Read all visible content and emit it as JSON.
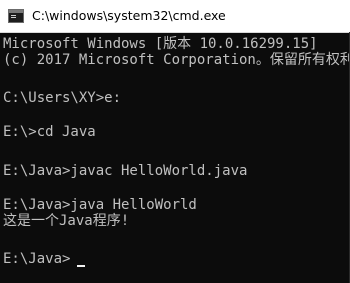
{
  "window": {
    "title": "C:\\windows\\system32\\cmd.exe"
  },
  "console": {
    "lines": [
      "Microsoft Windows [版本 10.0.16299.15]",
      "(c) 2017 Microsoft Corporation。保留所有权利。",
      "",
      "C:\\Users\\XY>e:",
      "",
      "E:\\>cd Java",
      "",
      "E:\\Java>javac HelloWorld.java",
      "",
      "E:\\Java>java HelloWorld",
      "这是一个Java程序!",
      "",
      "E:\\Java>"
    ]
  },
  "colors": {
    "console_background": "#0c0c0c",
    "console_text": "#c0c0c0",
    "titlebar_background": "#ffffff"
  },
  "icons": {
    "app": "cmd-console-icon"
  }
}
